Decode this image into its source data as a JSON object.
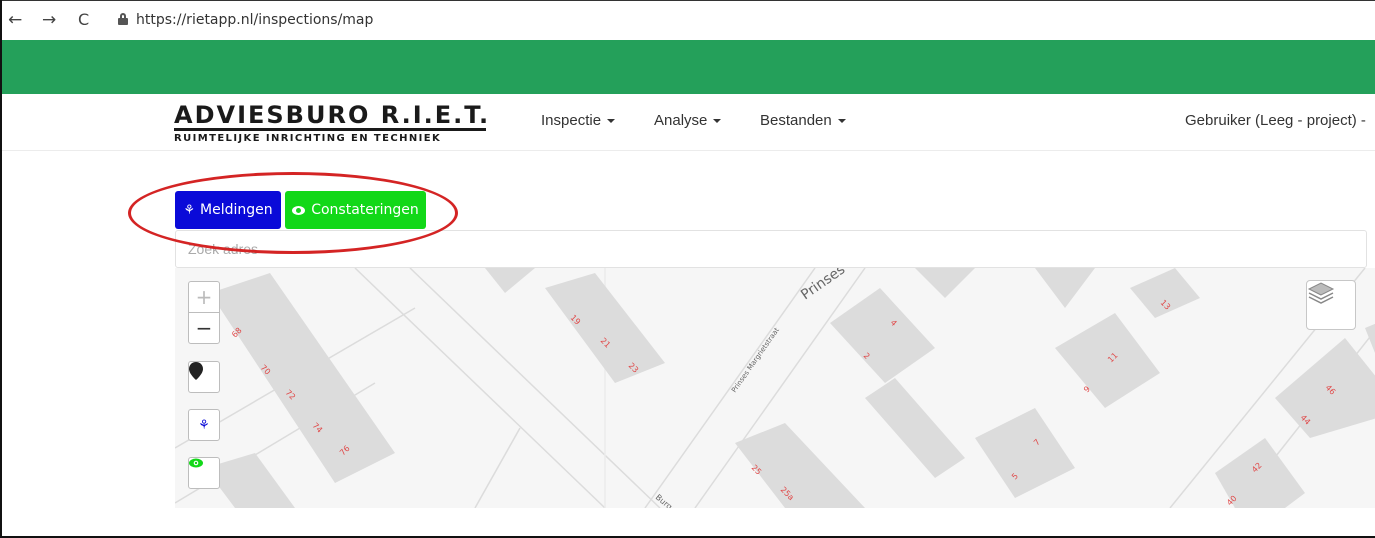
{
  "browser": {
    "back": "←",
    "forward": "→",
    "reload": "C",
    "url": "https://rietapp.nl/inspections/map"
  },
  "header": {
    "logo_title": "ADVIESBURO R.I.E.T.",
    "logo_subtitle": "RUIMTELIJKE INRICHTING EN TECHNIEK",
    "menu": [
      {
        "label": "Inspectie"
      },
      {
        "label": "Analyse"
      },
      {
        "label": "Bestanden"
      }
    ],
    "user": "Gebruiker (Leeg - project)"
  },
  "toolbar": {
    "meldingen_label": "Meldingen",
    "constateringen_label": "Constateringen"
  },
  "search": {
    "placeholder": "Zoek adres"
  },
  "map": {
    "zoom_in": "+",
    "zoom_out": "−",
    "pin_icon": "map-marker-icon",
    "plant_icon": "plant-icon",
    "eye_icon": "eye-icon",
    "layers_icon": "layers-icon",
    "streets": [
      "Prinses Margrietstraat",
      "Prinses",
      "Burg v"
    ],
    "house_numbers": [
      "68",
      "70",
      "72",
      "74",
      "76",
      "19",
      "21",
      "23",
      "2",
      "4",
      "25",
      "25a",
      "5",
      "7",
      "9",
      "11",
      "13",
      "46",
      "44",
      "42",
      "40"
    ]
  },
  "colors": {
    "green_bar": "#24a05a",
    "meldingen_btn": "#0a0ad8",
    "constateringen_btn": "#12d818",
    "annotation": "#d42424",
    "house_number": "#e04848"
  }
}
